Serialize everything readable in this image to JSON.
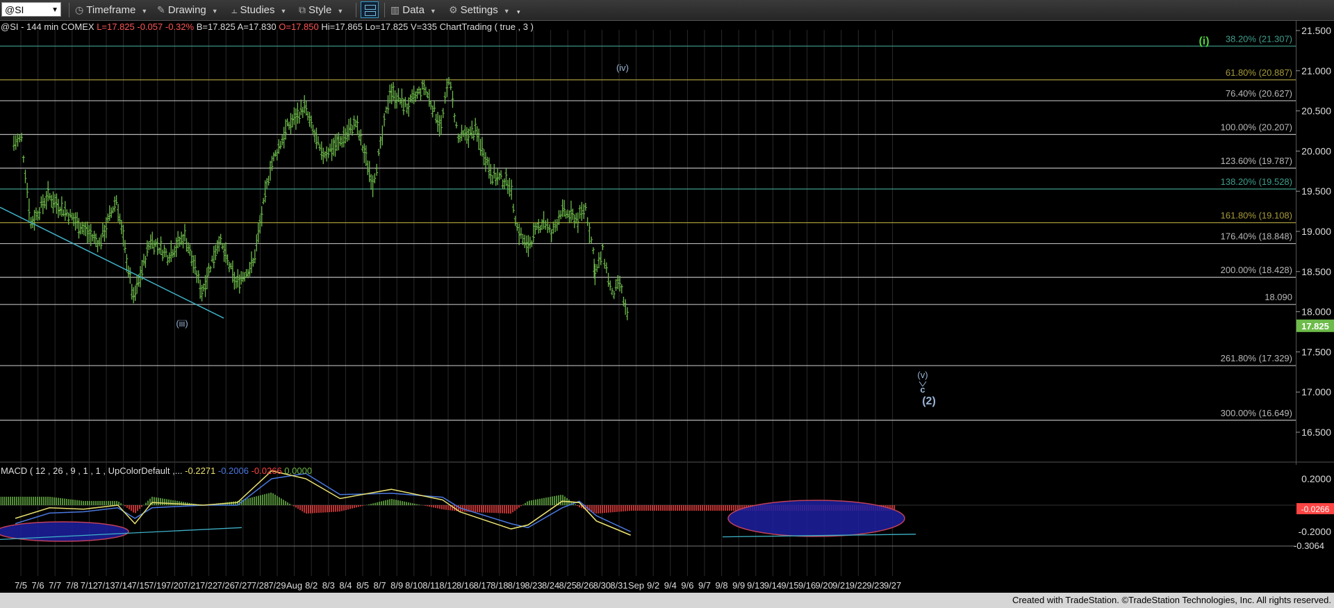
{
  "toolbar": {
    "symbol": "@SI",
    "timeframe": "Timeframe",
    "drawing": "Drawing",
    "studies": "Studies",
    "style": "Style",
    "data": "Data",
    "settings": "Settings"
  },
  "header": {
    "prefix": "@SI - 144 min  COMEX  ",
    "last": "L=17.825",
    "chg": "-0.057",
    "pct": "-0.32%",
    "bid": "B=17.825",
    "ask": "A=17.830",
    "open": "O=17.850",
    "hi": "Hi=17.865",
    "lo": "Lo=17.825",
    "vol": "V=335",
    "study": "ChartTrading ( true , 3 )"
  },
  "colors": {
    "bar": "#6dbb4a",
    "neg": "#ff4444",
    "grid": "#2a2a2a",
    "fib_white": "#b8b8b8",
    "fib_teal": "#3f9e8c",
    "fib_olive": "#a69a3a",
    "wave": "#9ab4d6",
    "macd": "#e8e070",
    "signal": "#4a78e0",
    "ellipse": "#1c20a0"
  },
  "price_axis": {
    "ticks": [
      "21.500",
      "21.000",
      "20.500",
      "20.000",
      "19.500",
      "19.000",
      "18.500",
      "18.000",
      "17.500",
      "17.000",
      "16.500"
    ],
    "current": "17.825"
  },
  "fib_levels": [
    {
      "label": "38.20% (21.307)",
      "value": 21.307,
      "color": "teal"
    },
    {
      "label": "61.80% (20.887)",
      "value": 20.887,
      "color": "olive"
    },
    {
      "label": "76.40% (20.627)",
      "value": 20.627,
      "color": "white"
    },
    {
      "label": "100.00% (20.207)",
      "value": 20.207,
      "color": "white"
    },
    {
      "label": "123.60% (19.787)",
      "value": 19.787,
      "color": "white"
    },
    {
      "label": "138.20% (19.528)",
      "value": 19.528,
      "color": "teal"
    },
    {
      "label": "161.80% (19.108)",
      "value": 19.108,
      "color": "olive"
    },
    {
      "label": "176.40% (18.848)",
      "value": 18.848,
      "color": "white"
    },
    {
      "label": "200.00% (18.428)",
      "value": 18.428,
      "color": "white"
    },
    {
      "label": "18.090",
      "value": 18.09,
      "color": "white"
    },
    {
      "label": "261.80% (17.329)",
      "value": 17.329,
      "color": "white"
    },
    {
      "label": "300.00% (16.649)",
      "value": 16.649,
      "color": "white"
    }
  ],
  "wave_labels": {
    "green_i": "(i)",
    "iii": "(iii)",
    "iv": "(iv)",
    "v": "(v)",
    "c": "c",
    "two": "(2)"
  },
  "macd": {
    "header": "MACD ( 12 , 26 , 9 , 1 , 1 , UpColorDefault ,...",
    "v1": "-0.2271",
    "v2": "-0.2006",
    "v3": "-0.0266",
    "v4": "0.0000",
    "ticks": [
      "0.2000",
      "-0.2000"
    ],
    "current": "-0.0266",
    "low_label": "-0.3064"
  },
  "dates": [
    "7/5",
    "7/6",
    "7/7",
    "7/8",
    "7/12",
    "7/13",
    "7/14",
    "7/15",
    "7/19",
    "7/20",
    "7/21",
    "7/22",
    "7/26",
    "7/27",
    "7/28",
    "7/29",
    "Aug",
    "8/2",
    "8/3",
    "8/4",
    "8/5",
    "8/7",
    "8/9",
    "8/10",
    "8/11",
    "8/12",
    "8/16",
    "8/17",
    "8/18",
    "8/19",
    "8/23",
    "8/24",
    "8/25",
    "8/26",
    "8/30",
    "8/31",
    "Sep",
    "9/2",
    "9/4",
    "9/6",
    "9/7",
    "9/8",
    "9/9",
    "9/13",
    "9/14",
    "9/15",
    "9/16",
    "9/20",
    "9/21",
    "9/22",
    "9/23",
    "9/27"
  ],
  "footer": "Created with TradeStation. ©TradeStation Technologies, Inc. All rights reserved.",
  "chart_data": {
    "type": "ohlc",
    "symbol": "@SI",
    "interval": "144 min",
    "ylim": [
      16.25,
      21.7
    ],
    "pivots": [
      {
        "date": "7/5",
        "price": 20.1
      },
      {
        "date": "7/5",
        "price": 20.15
      },
      {
        "date": "7/6",
        "price": 19.1
      },
      {
        "date": "7/7",
        "price": 19.45
      },
      {
        "date": "7/8",
        "price": 19.25
      },
      {
        "date": "7/13",
        "price": 18.85
      },
      {
        "date": "7/14",
        "price": 19.4
      },
      {
        "date": "7/15",
        "price": 18.15
      },
      {
        "date": "7/19",
        "price": 18.9
      },
      {
        "date": "7/20",
        "price": 18.7
      },
      {
        "date": "7/21",
        "price": 18.95
      },
      {
        "date": "7/22",
        "price": 18.25
      },
      {
        "date": "7/26",
        "price": 18.9
      },
      {
        "date": "7/27",
        "price": 18.35
      },
      {
        "date": "7/28",
        "price": 18.6
      },
      {
        "date": "7/29",
        "price": 19.8
      },
      {
        "date": "Aug",
        "price": 20.3
      },
      {
        "date": "8/2",
        "price": 20.55
      },
      {
        "date": "8/3",
        "price": 19.95
      },
      {
        "date": "8/4",
        "price": 20.1
      },
      {
        "date": "8/5",
        "price": 20.35
      },
      {
        "date": "8/7",
        "price": 19.6
      },
      {
        "date": "8/7",
        "price": 20.05
      },
      {
        "date": "8/9",
        "price": 20.75
      },
      {
        "date": "8/10",
        "price": 20.55
      },
      {
        "date": "8/11",
        "price": 20.8
      },
      {
        "date": "8/12",
        "price": 20.3
      },
      {
        "date": "8/12",
        "price": 20.92
      },
      {
        "date": "8/16",
        "price": 20.15
      },
      {
        "date": "8/17",
        "price": 20.25
      },
      {
        "date": "8/18",
        "price": 19.7
      },
      {
        "date": "8/19",
        "price": 19.6
      },
      {
        "date": "8/19",
        "price": 19.05
      },
      {
        "date": "8/23",
        "price": 18.8
      },
      {
        "date": "8/24",
        "price": 19.15
      },
      {
        "date": "8/24",
        "price": 18.95
      },
      {
        "date": "8/25",
        "price": 19.25
      },
      {
        "date": "8/26",
        "price": 19.15
      },
      {
        "date": "8/26",
        "price": 19.3
      },
      {
        "date": "8/26",
        "price": 18.75
      },
      {
        "date": "8/30",
        "price": 18.45
      },
      {
        "date": "8/30",
        "price": 18.75
      },
      {
        "date": "8/31",
        "price": 18.2
      },
      {
        "date": "8/31",
        "price": 18.35
      },
      {
        "date": "Sep",
        "price": 17.825
      }
    ],
    "macd_series": [
      {
        "date": "7/5",
        "macd": -0.1,
        "signal": -0.14
      },
      {
        "date": "7/7",
        "macd": -0.02,
        "signal": -0.06
      },
      {
        "date": "7/12",
        "macd": -0.03,
        "signal": -0.05
      },
      {
        "date": "7/14",
        "macd": 0.0,
        "signal": -0.02
      },
      {
        "date": "7/15",
        "macd": -0.14,
        "signal": -0.1
      },
      {
        "date": "7/19",
        "macd": 0.02,
        "signal": -0.02
      },
      {
        "date": "7/22",
        "macd": 0.0,
        "signal": 0.0
      },
      {
        "date": "7/27",
        "macd": 0.02,
        "signal": 0.0
      },
      {
        "date": "7/29",
        "macd": 0.26,
        "signal": 0.2
      },
      {
        "date": "8/2",
        "macd": 0.2,
        "signal": 0.24
      },
      {
        "date": "8/4",
        "macd": 0.05,
        "signal": 0.08
      },
      {
        "date": "8/9",
        "macd": 0.12,
        "signal": 0.09
      },
      {
        "date": "8/12",
        "macd": 0.04,
        "signal": 0.06
      },
      {
        "date": "8/16",
        "macd": -0.05,
        "signal": -0.02
      },
      {
        "date": "8/19",
        "macd": -0.18,
        "signal": -0.14
      },
      {
        "date": "8/23",
        "macd": -0.15,
        "signal": -0.17
      },
      {
        "date": "8/25",
        "macd": 0.03,
        "signal": -0.02
      },
      {
        "date": "8/26",
        "macd": 0.02,
        "signal": 0.03
      },
      {
        "date": "8/30",
        "macd": -0.12,
        "signal": -0.08
      },
      {
        "date": "Sep",
        "macd": -0.2271,
        "signal": -0.2006
      }
    ]
  }
}
